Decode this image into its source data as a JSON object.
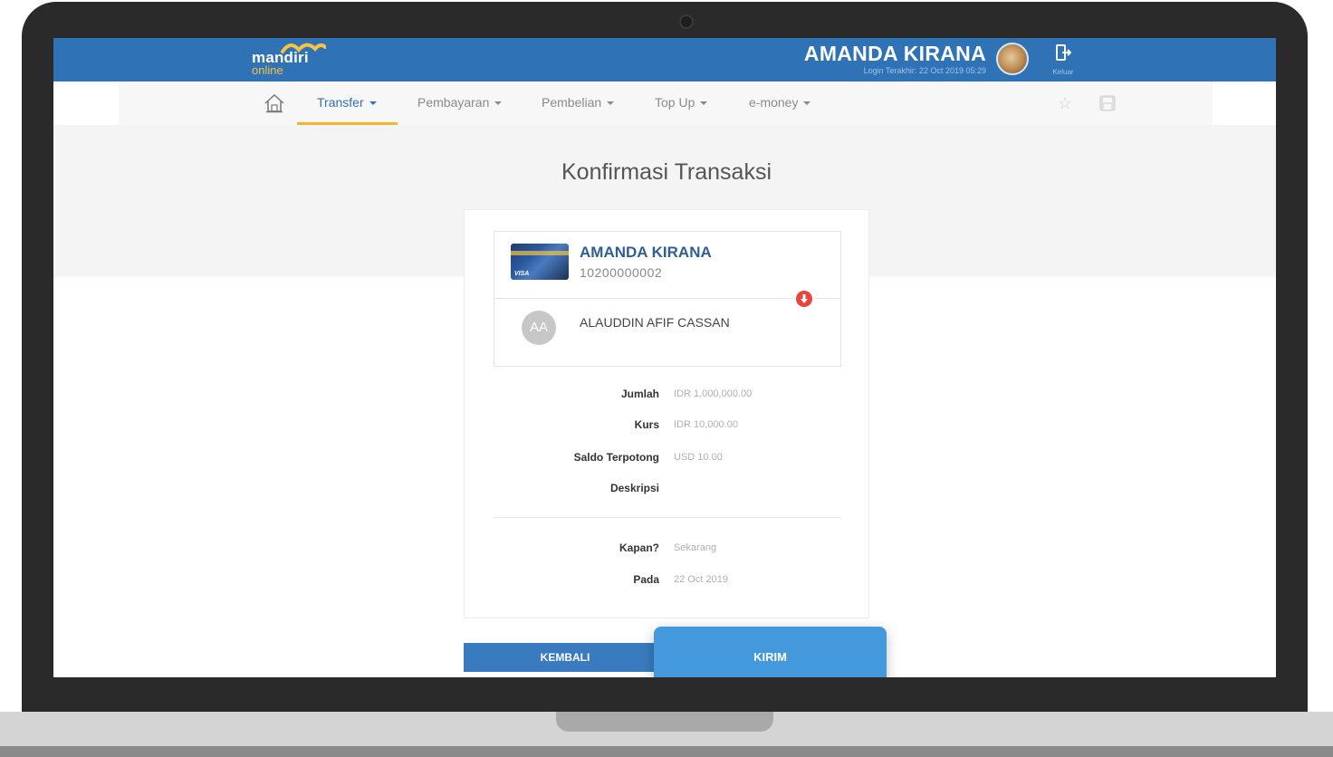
{
  "header": {
    "logo_text": "mandiri",
    "logo_sub": "online",
    "user_name": "AMANDA KIRANA",
    "last_login": "Login Terakhir: 22 Oct 2019 05:29",
    "logout_label": "Keluar"
  },
  "nav": {
    "items": [
      {
        "label": "Transfer",
        "active": true
      },
      {
        "label": "Pembayaran",
        "active": false
      },
      {
        "label": "Pembelian",
        "active": false
      },
      {
        "label": "Top Up",
        "active": false
      },
      {
        "label": "e-money",
        "active": false
      }
    ]
  },
  "page": {
    "title": "Konfirmasi Transaksi"
  },
  "sender": {
    "name": "AMANDA KIRANA",
    "account": "10200000002",
    "card_brand": "VISA"
  },
  "recipient": {
    "initials": "AA",
    "name": "ALAUDDIN AFIF CASSAN"
  },
  "details": [
    {
      "label": "Jumlah",
      "value": "IDR 1,000,000.00"
    },
    {
      "label": "Kurs",
      "value": "IDR 10,000.00"
    },
    {
      "label": "Saldo Terpotong",
      "value": "USD 10.00"
    },
    {
      "label": "Deskripsi",
      "value": ""
    }
  ],
  "schedule": [
    {
      "label": "Kapan?",
      "value": "Sekarang"
    },
    {
      "label": "Pada",
      "value": "22 Oct 2019"
    }
  ],
  "buttons": {
    "back_label": "KEMBALI",
    "send_label": "KIRIM"
  },
  "colors": {
    "brand_blue": "#2f72b5",
    "accent_yellow": "#f6b530",
    "send_button": "#4499dd",
    "back_button": "#3a7bbf",
    "alert_red": "#e8453c"
  }
}
